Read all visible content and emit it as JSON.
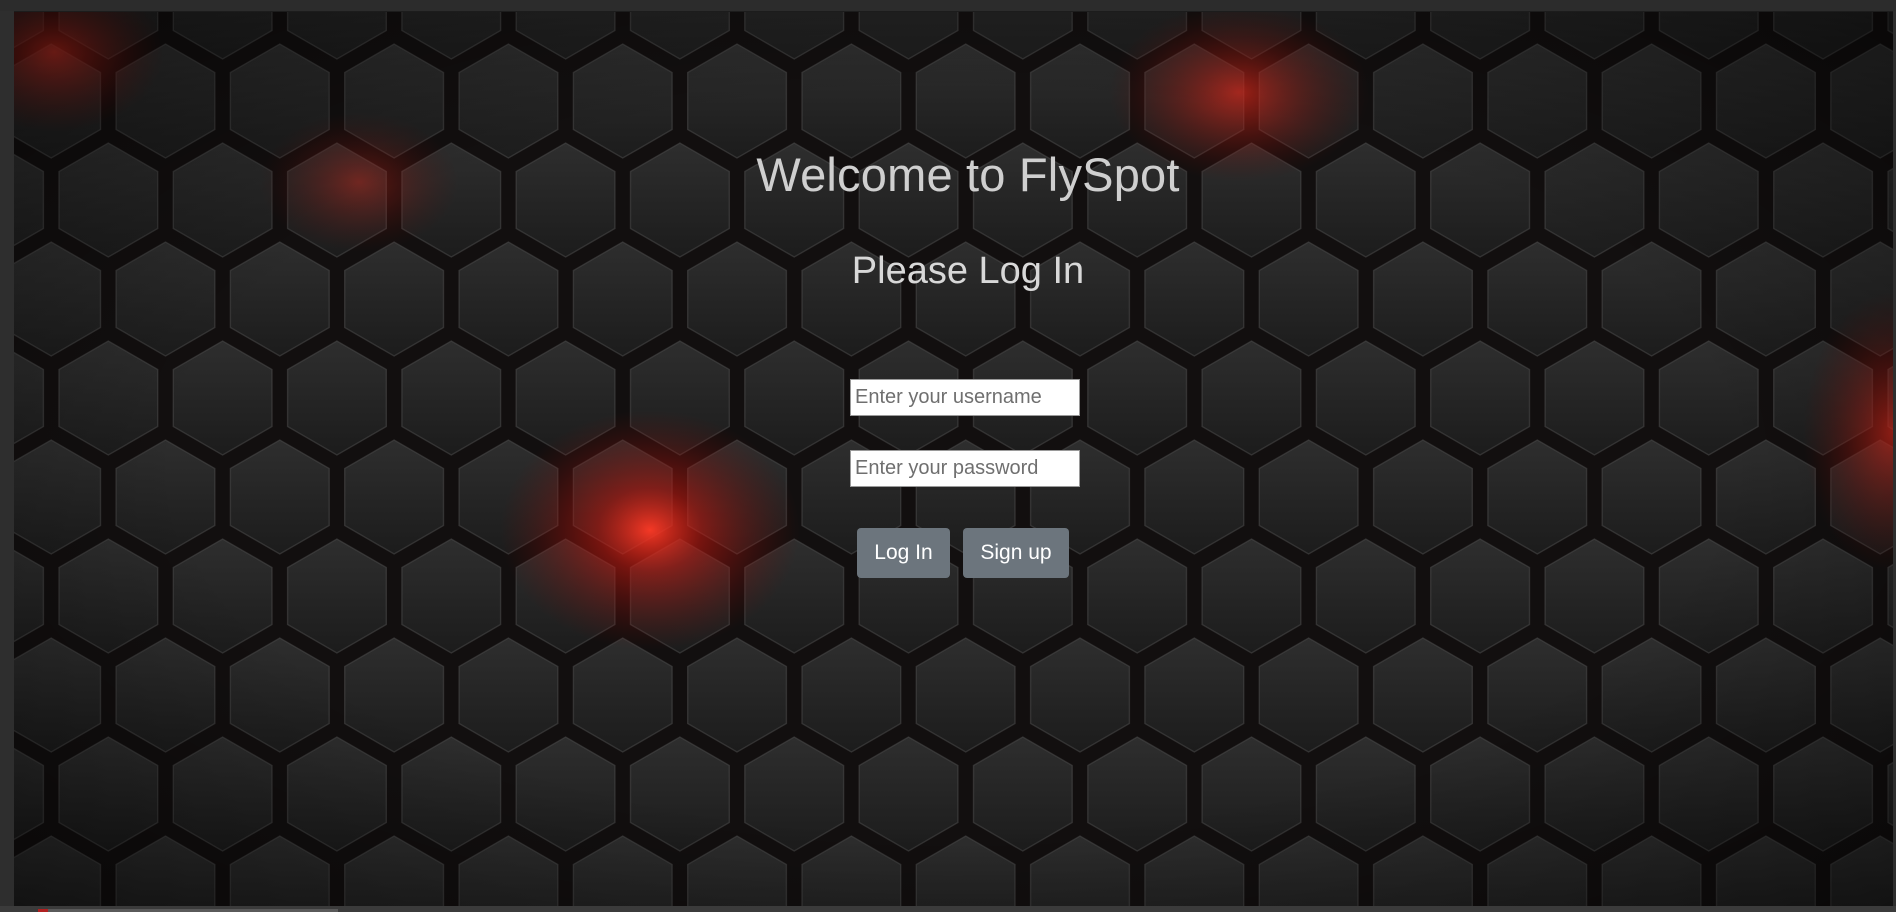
{
  "page": {
    "title": "Welcome to FlySpot",
    "subtitle": "Please Log In"
  },
  "form": {
    "username": {
      "value": "",
      "placeholder": "Enter your username"
    },
    "password": {
      "value": "",
      "placeholder": "Enter your password"
    },
    "login_label": "Log In",
    "signup_label": "Sign up"
  },
  "colors": {
    "background": "#101010",
    "hex_tile": "#262626",
    "accent_glow": "#e0261c",
    "button": "#6c757d",
    "heading_text": "#cfcfcf"
  },
  "background_pattern": "dark-hexagon-tiles-with-red-glow"
}
